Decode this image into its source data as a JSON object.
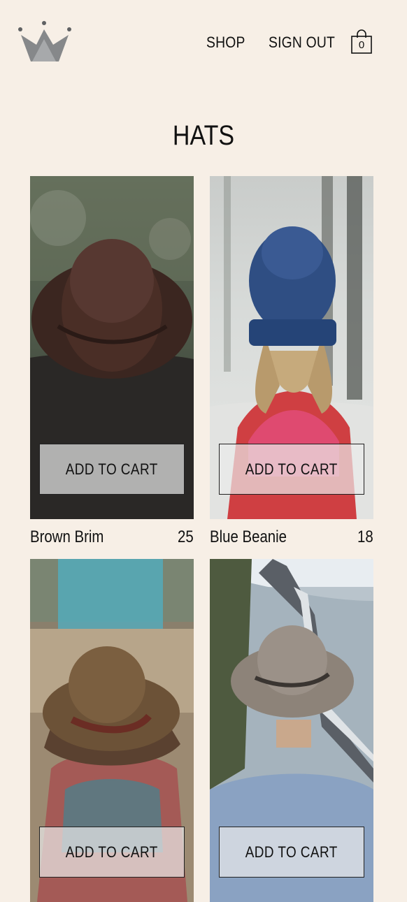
{
  "header": {
    "logo_icon": "crown-icon",
    "nav": [
      {
        "label": "SHOP"
      },
      {
        "label": "SIGN OUT"
      }
    ],
    "cart": {
      "icon": "shopping-bag-icon",
      "count": "0"
    }
  },
  "page": {
    "title": "HATS"
  },
  "products": [
    {
      "name": "Brown Brim",
      "price": "25",
      "button_label": "ADD TO CART"
    },
    {
      "name": "Blue Beanie",
      "price": "18",
      "button_label": "ADD TO CART"
    },
    {
      "name": "",
      "price": "",
      "button_label": "ADD TO CART"
    },
    {
      "name": "",
      "price": "",
      "button_label": "ADD TO CART"
    }
  ],
  "colors": {
    "background": "#f7efe6",
    "text": "#111111",
    "logo": "#7f8183"
  }
}
